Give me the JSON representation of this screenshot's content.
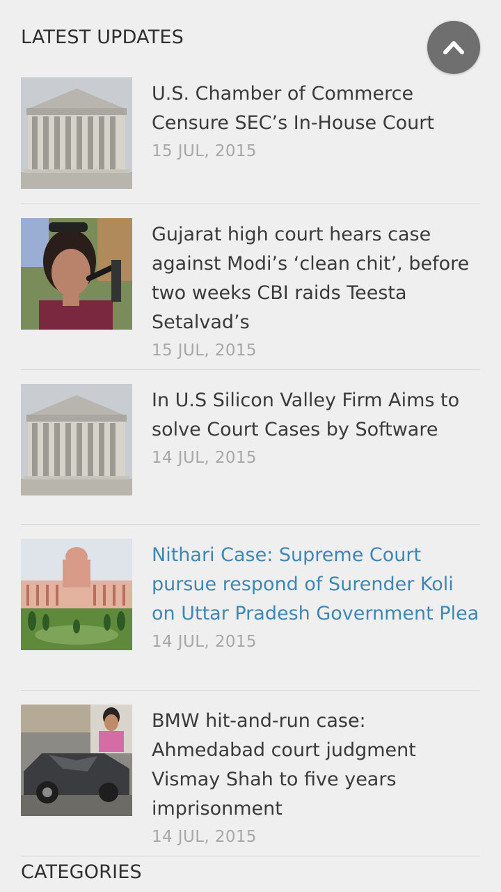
{
  "latest": {
    "heading": "LATEST UPDATES",
    "items": [
      {
        "title": "U.S. Chamber of Commerce Censure SEC’s In-House Court",
        "date": "15 JUL, 2015",
        "image": "supreme-court-building"
      },
      {
        "title": "Gujarat high court hears case against Modi’s ‘clean chit’, before two weeks CBI raids Teesta Setalvad’s",
        "date": "15 JUL, 2015",
        "image": "woman-speaking-at-microphone"
      },
      {
        "title": "In U.S Silicon Valley Firm Aims to solve Court Cases by Software",
        "date": "14 JUL, 2015",
        "image": "supreme-court-building"
      },
      {
        "title": "Nithari Case: Supreme Court pursue respond of Surender Koli on Uttar Pradesh Government Plea",
        "date": "14 JUL, 2015",
        "image": "indian-supreme-court-building"
      },
      {
        "title": "BMW hit-and-run case: Ahmedabad court judgment Vismay Shah to five years imprisonment",
        "date": "14 JUL, 2015",
        "image": "wrecked-car-and-man-on-phone"
      }
    ]
  },
  "categories": {
    "heading": "CATEGORIES"
  },
  "scroll_top": {
    "icon": "chevron-up-icon"
  },
  "colors": {
    "active_link": "#3d87b5",
    "date": "#a7a7a7",
    "background": "#efefef"
  }
}
